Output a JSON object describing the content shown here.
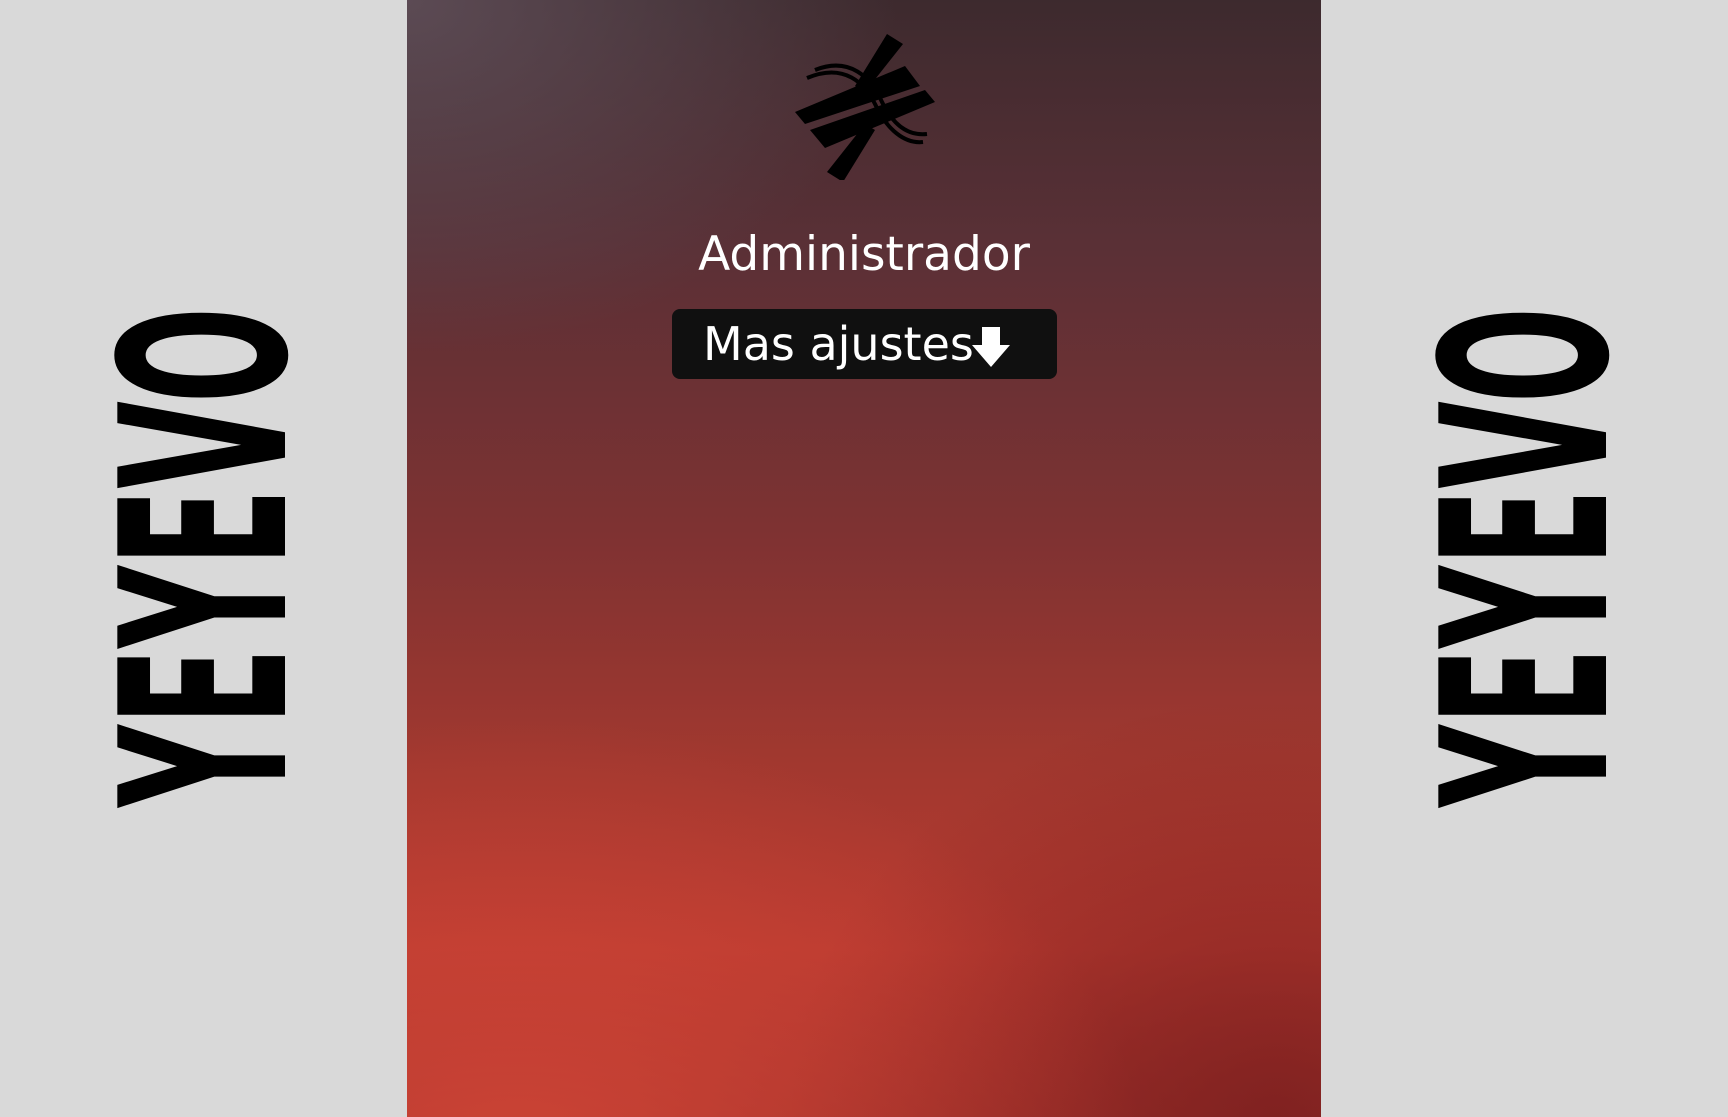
{
  "sidebar_left": {
    "brand": "YEYEVO"
  },
  "sidebar_right": {
    "brand": "YEYEVO"
  },
  "panel": {
    "logo_icon": "x-star-logo-icon",
    "title": "Administrador",
    "more_button": {
      "label": "Mas ajustes",
      "icon": "arrow-down-icon"
    }
  },
  "colors": {
    "side_background": "#d9d9d9",
    "button_background": "#101010",
    "text": "#ffffff",
    "panel_top": "#3d2a2e",
    "panel_bottom": "#b83a30"
  }
}
